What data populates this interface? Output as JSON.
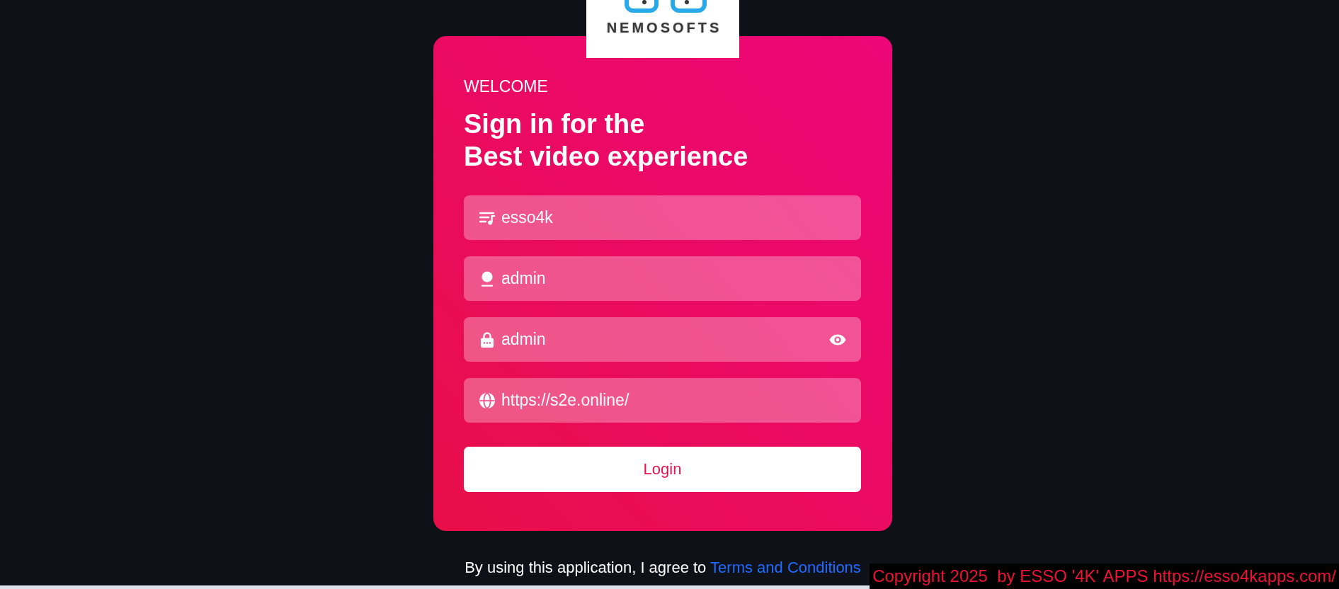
{
  "logo": {
    "wordmark": "NEMOSOFTS"
  },
  "card": {
    "eyebrow": "WELCOME",
    "title": "Sign in for the\nBest video experience"
  },
  "fields": [
    {
      "kind": "playlist",
      "value": "esso4k"
    },
    {
      "kind": "user",
      "value": "admin"
    },
    {
      "kind": "password",
      "value": "admin"
    },
    {
      "kind": "url",
      "value": "https://s2e.online/"
    }
  ],
  "login_button": {
    "label": "Login"
  },
  "agreement": {
    "text": "By using this application, I agree to",
    "link": "Terms and Conditions"
  },
  "copyright": "Copyright 2025  by ESSO '4K' APPS https://esso4kapps.com/"
}
